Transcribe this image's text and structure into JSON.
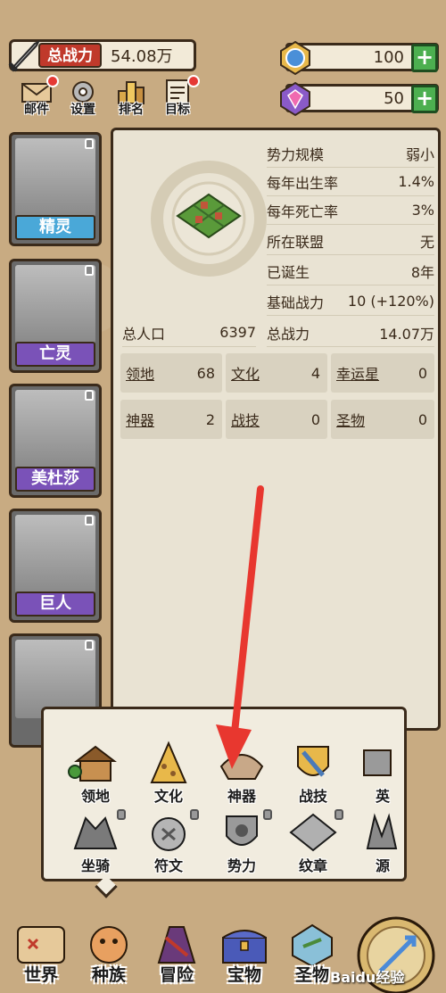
{
  "header": {
    "power_label": "总战力",
    "power_value": "54.08万",
    "resource1_value": "100",
    "resource2_value": "50",
    "plus": "+"
  },
  "top_buttons": [
    {
      "label": "邮件",
      "icon": "mail-icon",
      "badge": true
    },
    {
      "label": "设置",
      "icon": "gear-icon",
      "badge": false
    },
    {
      "label": "排名",
      "icon": "ranking-icon",
      "badge": false
    },
    {
      "label": "目标",
      "icon": "goal-icon",
      "badge": true
    }
  ],
  "characters": [
    {
      "name": "精灵"
    },
    {
      "name": "亡灵"
    },
    {
      "name": "美杜莎"
    },
    {
      "name": "巨人"
    },
    {
      "name": ""
    }
  ],
  "info": {
    "stats": [
      {
        "label": "势力规模",
        "value": "弱小"
      },
      {
        "label": "每年出生率",
        "value": "1.4%"
      },
      {
        "label": "每年死亡率",
        "value": "3%"
      },
      {
        "label": "所在联盟",
        "value": "无"
      },
      {
        "label": "已诞生",
        "value": "8年"
      },
      {
        "label": "基础战力",
        "value": "10 (+120%)"
      },
      {
        "label": "总战力",
        "value": "14.07万"
      }
    ],
    "population_label": "总人口",
    "population_value": "6397",
    "grid": [
      {
        "label": "领地",
        "value": "68"
      },
      {
        "label": "文化",
        "value": "4"
      },
      {
        "label": "幸运星",
        "value": "0"
      },
      {
        "label": "神器",
        "value": "2"
      },
      {
        "label": "战技",
        "value": "0"
      },
      {
        "label": "圣物",
        "value": "0"
      }
    ]
  },
  "popup_menu": [
    {
      "label": "领地",
      "icon": "territory-icon",
      "locked": false
    },
    {
      "label": "文化",
      "icon": "culture-icon",
      "locked": false
    },
    {
      "label": "神器",
      "icon": "artifact-icon",
      "locked": false
    },
    {
      "label": "战技",
      "icon": "battle-skill-icon",
      "locked": false
    },
    {
      "label": "英",
      "icon": "hero-icon",
      "locked": false
    },
    {
      "label": "坐骑",
      "icon": "mount-icon",
      "locked": true
    },
    {
      "label": "符文",
      "icon": "rune-icon",
      "locked": true
    },
    {
      "label": "势力",
      "icon": "faction-icon",
      "locked": true
    },
    {
      "label": "纹章",
      "icon": "crest-icon",
      "locked": true
    },
    {
      "label": "源",
      "icon": "source-icon",
      "locked": false
    }
  ],
  "bottom_nav": [
    {
      "label": "世界",
      "icon": "world-icon"
    },
    {
      "label": "种族",
      "icon": "race-icon"
    },
    {
      "label": "冒险",
      "icon": "adventure-icon"
    },
    {
      "label": "宝物",
      "icon": "treasure-icon"
    },
    {
      "label": "圣物",
      "icon": "relic-icon"
    }
  ],
  "watermark": "Baidu经验",
  "colors": {
    "background": "#c8ab82",
    "panel": "#e9e3d3",
    "plus_green": "#4caf50",
    "power_red": "#c0392b",
    "char_name_purple": "#7a52b8",
    "char_name_blue": "#4aa8d8",
    "arrow_red": "#e8372f"
  }
}
